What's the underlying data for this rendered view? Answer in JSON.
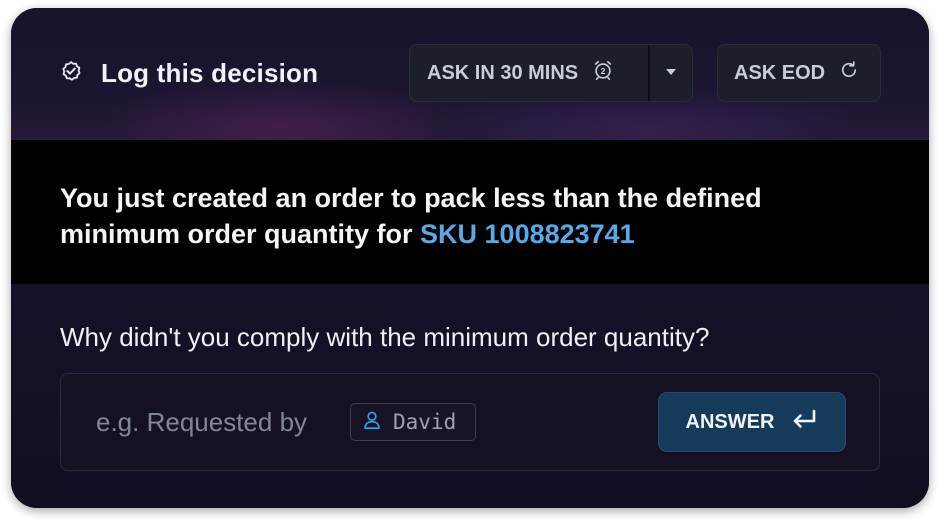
{
  "header": {
    "title": "Log this decision",
    "title_icon": "check-badge-icon",
    "ask_later_label": "ASK IN 30 MINS",
    "ask_later_icon": "alarm-clock-icon",
    "ask_later_menu_icon": "caret-down-icon",
    "ask_eod_label": "ASK EOD",
    "ask_eod_icon": "refresh-icon"
  },
  "message": {
    "text": "You just created an order to pack less than the defined minimum order quantity for ",
    "sku_link": "SKU 1008823741"
  },
  "form": {
    "question": "Why didn't you comply with the minimum order quantity?",
    "placeholder": "e.g. Requested by",
    "chip_name": "David",
    "chip_icon": "user-icon",
    "answer_label": "ANSWER",
    "answer_icon": "enter-icon"
  },
  "colors": {
    "accent_link": "#5aa9e6",
    "answer_button": "#163b5a",
    "card_background": "#130f24"
  }
}
